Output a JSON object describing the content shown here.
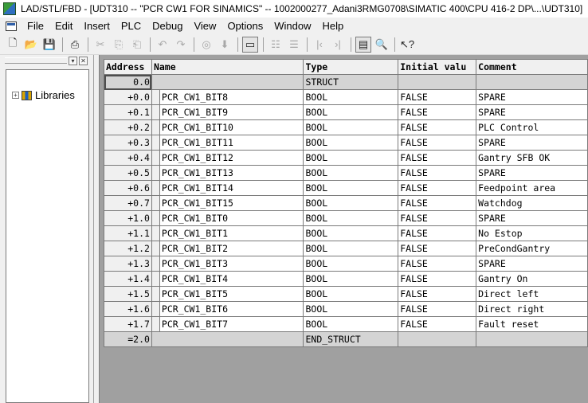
{
  "window": {
    "title": "LAD/STL/FBD  - [UDT310 -- \"PCR CW1 FOR SINAMICS\" -- 1002000277_Adani3RMG0708\\SIMATIC 400\\CPU 416-2 DP\\...\\UDT310]"
  },
  "menu": [
    {
      "label": "File"
    },
    {
      "label": "Edit"
    },
    {
      "label": "Insert"
    },
    {
      "label": "PLC"
    },
    {
      "label": "Debug"
    },
    {
      "label": "View"
    },
    {
      "label": "Options"
    },
    {
      "label": "Window"
    },
    {
      "label": "Help"
    }
  ],
  "toolbar": {
    "new": "new-document",
    "open": "open-folder",
    "save": "save-disk",
    "print": "printer",
    "cut": "cut",
    "copy": "copy",
    "paste": "paste",
    "undo": "undo",
    "redo": "redo",
    "monitor": "glasses",
    "download": "download",
    "window_toggle": "window",
    "net_a": "network",
    "net_b": "network-up",
    "nav_prev": "prev",
    "nav_next": "next",
    "overview": "overview",
    "zoom": "zoom",
    "help": "help-pointer"
  },
  "tree": {
    "items": [
      {
        "label": "Libraries"
      }
    ]
  },
  "table": {
    "headers": {
      "address": "Address",
      "name": "Name",
      "type": "Type",
      "initial": "Initial valu",
      "comment": "Comment"
    },
    "struct_start": {
      "address": "0.0",
      "type": "STRUCT"
    },
    "rows": [
      {
        "address": "+0.0",
        "name": "PCR_CW1_BIT8",
        "type": "BOOL",
        "initial": "FALSE",
        "comment": "SPARE"
      },
      {
        "address": "+0.1",
        "name": "PCR_CW1_BIT9",
        "type": "BOOL",
        "initial": "FALSE",
        "comment": "SPARE"
      },
      {
        "address": "+0.2",
        "name": "PCR_CW1_BIT10",
        "type": "BOOL",
        "initial": "FALSE",
        "comment": "PLC Control"
      },
      {
        "address": "+0.3",
        "name": "PCR_CW1_BIT11",
        "type": "BOOL",
        "initial": "FALSE",
        "comment": "SPARE"
      },
      {
        "address": "+0.4",
        "name": "PCR_CW1_BIT12",
        "type": "BOOL",
        "initial": "FALSE",
        "comment": "Gantry SFB OK"
      },
      {
        "address": "+0.5",
        "name": "PCR_CW1_BIT13",
        "type": "BOOL",
        "initial": "FALSE",
        "comment": "SPARE"
      },
      {
        "address": "+0.6",
        "name": "PCR_CW1_BIT14",
        "type": "BOOL",
        "initial": "FALSE",
        "comment": "Feedpoint area"
      },
      {
        "address": "+0.7",
        "name": "PCR_CW1_BIT15",
        "type": "BOOL",
        "initial": "FALSE",
        "comment": "Watchdog"
      },
      {
        "address": "+1.0",
        "name": "PCR_CW1_BIT0",
        "type": "BOOL",
        "initial": "FALSE",
        "comment": "SPARE"
      },
      {
        "address": "+1.1",
        "name": "PCR_CW1_BIT1",
        "type": "BOOL",
        "initial": "FALSE",
        "comment": "No Estop"
      },
      {
        "address": "+1.2",
        "name": "PCR_CW1_BIT2",
        "type": "BOOL",
        "initial": "FALSE",
        "comment": "PreCondGantry"
      },
      {
        "address": "+1.3",
        "name": "PCR_CW1_BIT3",
        "type": "BOOL",
        "initial": "FALSE",
        "comment": "SPARE"
      },
      {
        "address": "+1.4",
        "name": "PCR_CW1_BIT4",
        "type": "BOOL",
        "initial": "FALSE",
        "comment": "Gantry On"
      },
      {
        "address": "+1.5",
        "name": "PCR_CW1_BIT5",
        "type": "BOOL",
        "initial": "FALSE",
        "comment": "Direct left"
      },
      {
        "address": "+1.6",
        "name": "PCR_CW1_BIT6",
        "type": "BOOL",
        "initial": "FALSE",
        "comment": "Direct right"
      },
      {
        "address": "+1.7",
        "name": "PCR_CW1_BIT7",
        "type": "BOOL",
        "initial": "FALSE",
        "comment": "Fault reset"
      }
    ],
    "struct_end": {
      "address": "=2.0",
      "type": "END_STRUCT"
    }
  }
}
